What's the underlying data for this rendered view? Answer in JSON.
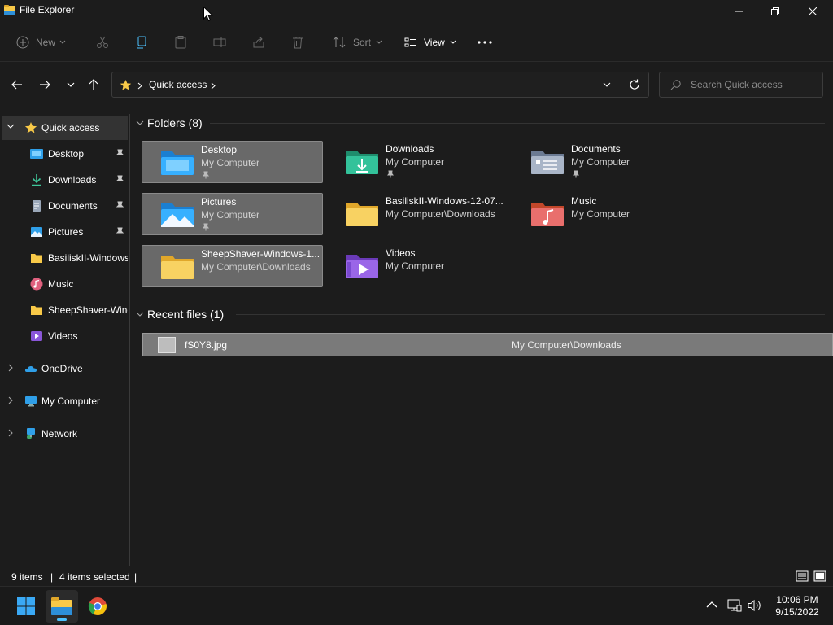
{
  "window": {
    "title": "File Explorer"
  },
  "toolbar": {
    "new_label": "New",
    "sort_label": "Sort",
    "view_label": "View"
  },
  "address": {
    "root_icon": "star-icon",
    "crumb": "Quick access"
  },
  "search": {
    "placeholder": "Search Quick access"
  },
  "sidebar": {
    "quick_access": "Quick access",
    "pinned": [
      {
        "label": "Desktop",
        "icon": "desktop-folder-icon",
        "pinned": true
      },
      {
        "label": "Downloads",
        "icon": "downloads-icon",
        "pinned": true
      },
      {
        "label": "Documents",
        "icon": "documents-icon",
        "pinned": true
      },
      {
        "label": "Pictures",
        "icon": "pictures-icon",
        "pinned": true
      },
      {
        "label": "BasiliskII-Windows",
        "icon": "folder-icon",
        "pinned": false
      },
      {
        "label": "Music",
        "icon": "music-icon",
        "pinned": false
      },
      {
        "label": "SheepShaver-Windows",
        "icon": "folder-icon",
        "pinned": false
      },
      {
        "label": "Videos",
        "icon": "videos-icon",
        "pinned": false
      }
    ],
    "roots": [
      {
        "label": "OneDrive",
        "icon": "onedrive-icon"
      },
      {
        "label": "My Computer",
        "icon": "computer-icon"
      },
      {
        "label": "Network",
        "icon": "network-icon"
      }
    ]
  },
  "folders_section": {
    "title": "Folders (8)",
    "items": [
      {
        "name": "Desktop",
        "path": "My Computer",
        "pinned": true,
        "selected": true
      },
      {
        "name": "Downloads",
        "path": "My Computer",
        "pinned": true,
        "selected": false
      },
      {
        "name": "Documents",
        "path": "My Computer",
        "pinned": true,
        "selected": false
      },
      {
        "name": "Pictures",
        "path": "My Computer",
        "pinned": true,
        "selected": true
      },
      {
        "name": "BasiliskII-Windows-12-07...",
        "path": "My Computer\\Downloads",
        "pinned": false,
        "selected": false
      },
      {
        "name": "Music",
        "path": "My Computer",
        "pinned": false,
        "selected": false
      },
      {
        "name": "SheepShaver-Windows-1...",
        "path": "My Computer\\Downloads",
        "pinned": false,
        "selected": true
      },
      {
        "name": "Videos",
        "path": "My Computer",
        "pinned": false,
        "selected": false
      }
    ]
  },
  "recent_section": {
    "title": "Recent files (1)",
    "files": [
      {
        "name": "fS0Y8.jpg",
        "location": "My Computer\\Downloads",
        "selected": true
      }
    ]
  },
  "status": {
    "items": "9 items",
    "selected": "4 items selected",
    "divider": "|"
  },
  "taskbar": {
    "apps": [
      "start-icon",
      "file-explorer-icon",
      "chrome-icon"
    ],
    "time": "10:06 PM",
    "date": "9/15/2022"
  },
  "colors": {
    "background": "#1c1c1c",
    "selection": "#696969",
    "accent": "#4cc2ff",
    "folder_yellow": "#f8c948"
  }
}
